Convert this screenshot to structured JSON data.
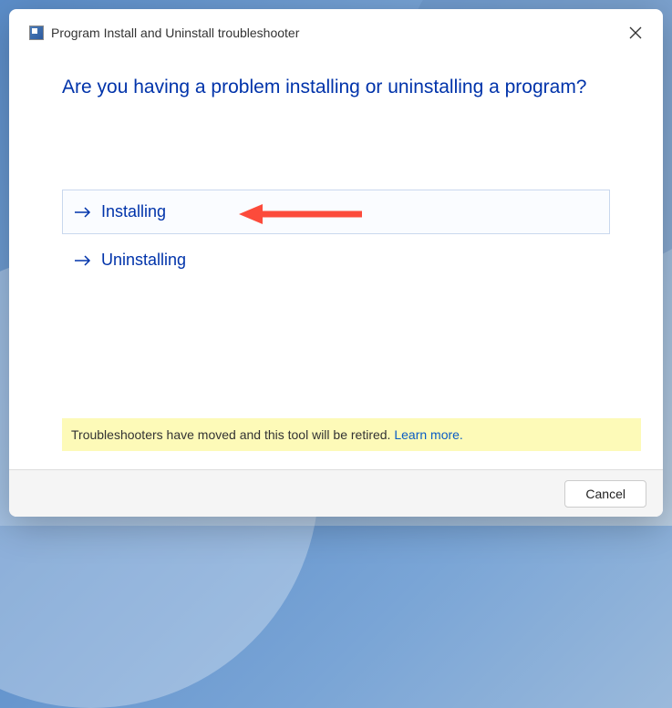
{
  "window": {
    "title": "Program Install and Uninstall troubleshooter"
  },
  "heading": "Are you having a problem installing or uninstalling a program?",
  "options": {
    "install": "Installing",
    "uninstall": "Uninstalling"
  },
  "banner": {
    "text": "Troubleshooters have moved and this tool will be retired. ",
    "link": "Learn more."
  },
  "footer": {
    "cancel": "Cancel"
  },
  "annotation": {
    "color": "#fc4b3b"
  }
}
